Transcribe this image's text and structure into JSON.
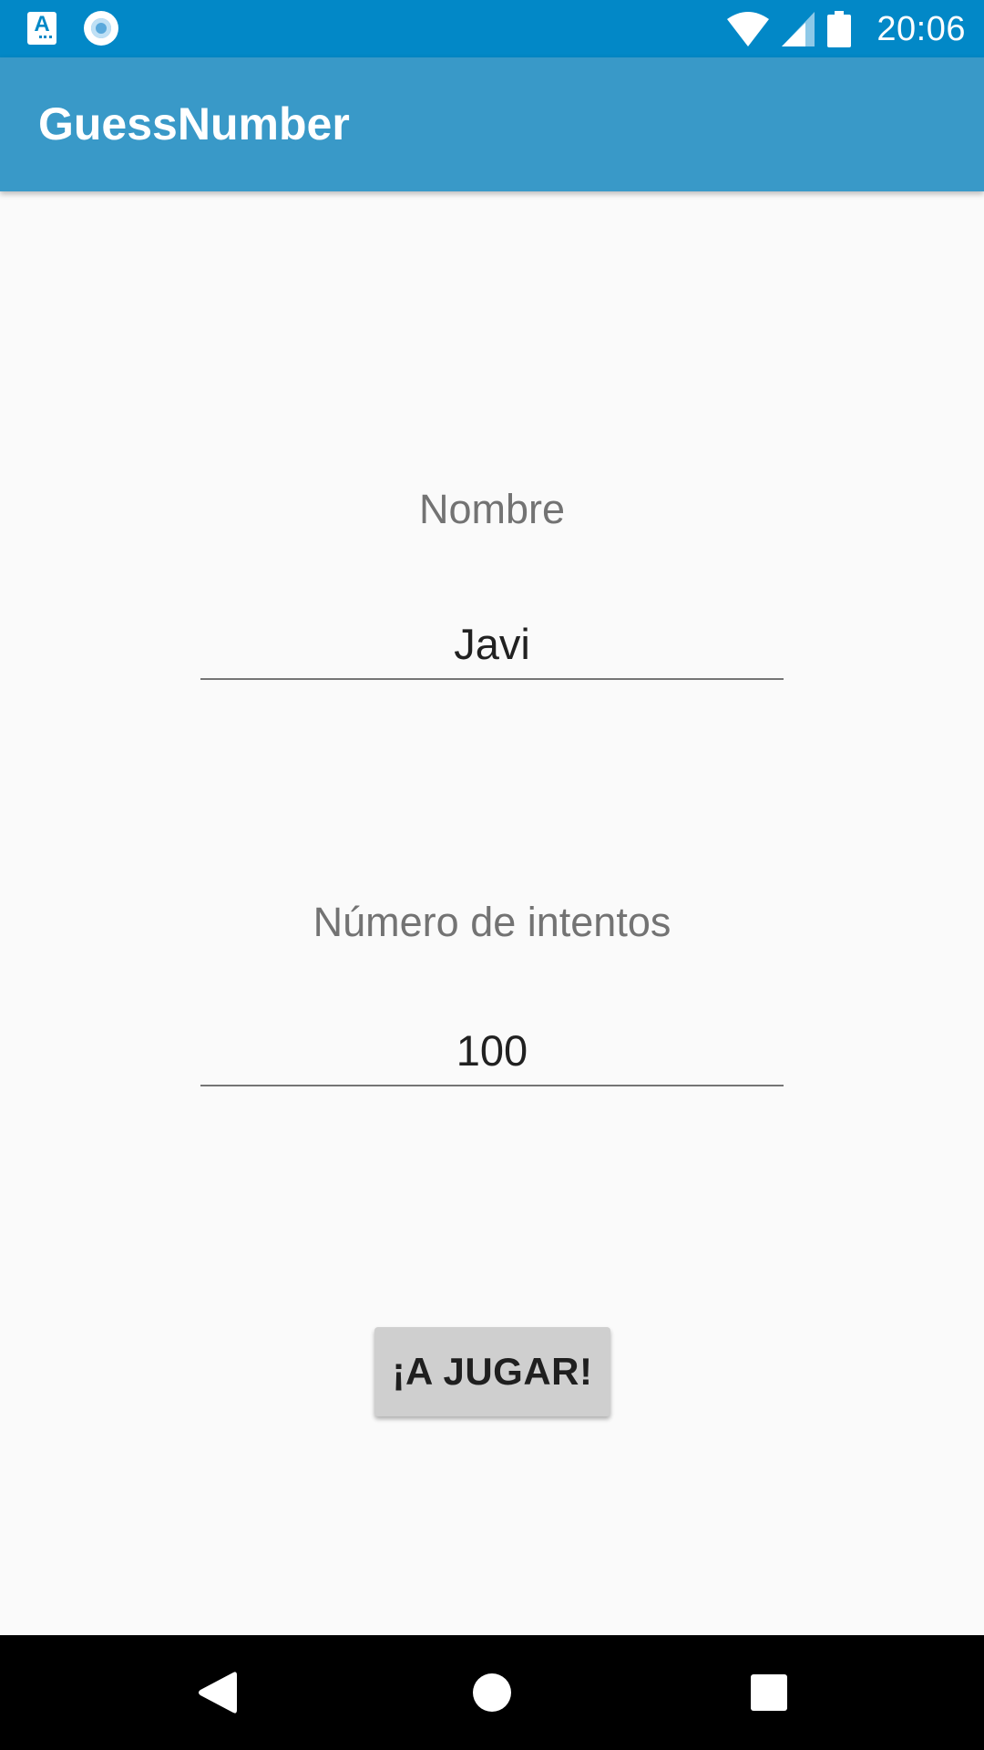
{
  "status_bar": {
    "time": "20:06",
    "icons": [
      "accessibility-a-icon",
      "record-circle-icon",
      "wifi-icon",
      "signal-icon",
      "battery-icon"
    ]
  },
  "app_bar": {
    "title": "GuessNumber"
  },
  "form": {
    "name_label": "Nombre",
    "name_value": "Javi",
    "attempts_label": "Número de intentos",
    "attempts_value": "100",
    "play_button": "¡A JUGAR!"
  },
  "nav_bar": {
    "icons": [
      "back-icon",
      "home-icon",
      "recents-icon"
    ]
  },
  "colors": {
    "status_bar": "#0288c7",
    "app_bar": "#3999c8",
    "background": "#fafafa",
    "button": "#cfcfcf"
  }
}
